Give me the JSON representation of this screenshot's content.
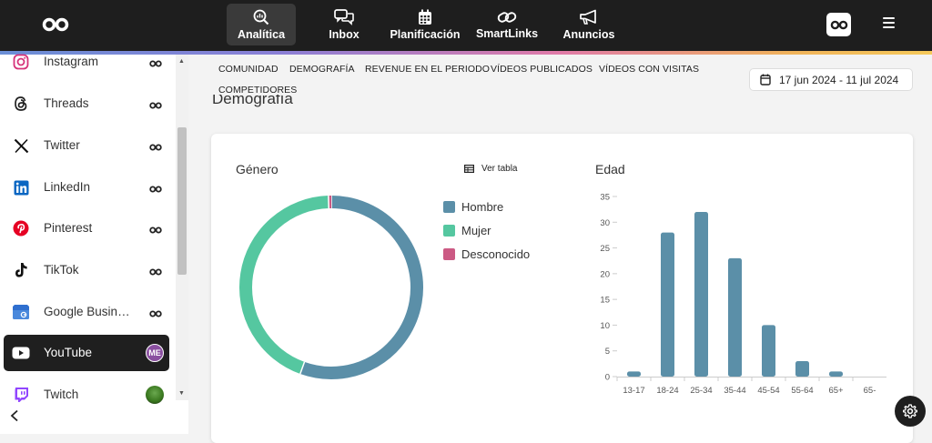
{
  "nav": {
    "items": [
      {
        "label": "Analítica",
        "icon": "analytics-search-icon",
        "active": true
      },
      {
        "label": "Inbox",
        "icon": "chat-bubbles-icon"
      },
      {
        "label": "Planificación",
        "icon": "calendar-icon"
      },
      {
        "label": "SmartLinks",
        "icon": "link-icon"
      },
      {
        "label": "Anuncios",
        "icon": "megaphone-icon"
      }
    ]
  },
  "sidebar": {
    "items": [
      {
        "label": "Instagram",
        "icon": "instagram-icon",
        "status": "infinity-icon"
      },
      {
        "label": "Threads",
        "icon": "threads-icon",
        "status": "infinity-icon"
      },
      {
        "label": "Twitter",
        "icon": "x-twitter-icon",
        "status": "infinity-icon"
      },
      {
        "label": "LinkedIn",
        "icon": "linkedin-icon",
        "status": "infinity-icon"
      },
      {
        "label": "Pinterest",
        "icon": "pinterest-icon",
        "status": "infinity-icon"
      },
      {
        "label": "TikTok",
        "icon": "tiktok-icon",
        "status": "infinity-icon"
      },
      {
        "label": "Google Business Profile",
        "icon": "google-business-icon",
        "status": "infinity-icon"
      },
      {
        "label": "YouTube",
        "icon": "youtube-icon",
        "status": "avatar",
        "avatar_text": "ME",
        "active": true
      },
      {
        "label": "Twitch",
        "icon": "twitch-icon",
        "status": "avatar-image"
      }
    ]
  },
  "tabs": [
    "COMUNIDAD",
    "DEMOGRAFÍA",
    "REVENUE EN EL PERIODO",
    "VÍDEOS PUBLICADOS",
    "VÍDEOS CON VISITAS",
    "COMPETIDORES"
  ],
  "date_range": "17 jun 2024 - 11 jul 2024",
  "section_title": "Demografía",
  "gender": {
    "title": "Género",
    "view_table": "Ver tabla",
    "legend": [
      {
        "label": "Hombre",
        "color": "#5b8fa8"
      },
      {
        "label": "Mujer",
        "color": "#55c7a0"
      },
      {
        "label": "Desconocido",
        "color": "#cc5a84"
      }
    ]
  },
  "chart_data": [
    {
      "type": "pie",
      "title": "Género",
      "categories": [
        "Hombre",
        "Mujer",
        "Desconocido"
      ],
      "values": [
        55.5,
        44,
        0.5
      ],
      "colors": [
        "#5b8fa8",
        "#55c7a0",
        "#cc5a84"
      ]
    },
    {
      "type": "bar",
      "title": "Edad",
      "categories": [
        "13-17",
        "18-24",
        "25-34",
        "35-44",
        "45-54",
        "55-64",
        "65+",
        "65-"
      ],
      "values": [
        1,
        28,
        32,
        23,
        10,
        3,
        1,
        0
      ],
      "ylim": [
        0,
        35
      ],
      "yticks": [
        0,
        5,
        10,
        15,
        20,
        25,
        30,
        35
      ],
      "grid": false,
      "color": "#5b8fa8"
    }
  ],
  "colors": {
    "accent": "#5b8fa8",
    "dark": "#1e1e1e"
  }
}
